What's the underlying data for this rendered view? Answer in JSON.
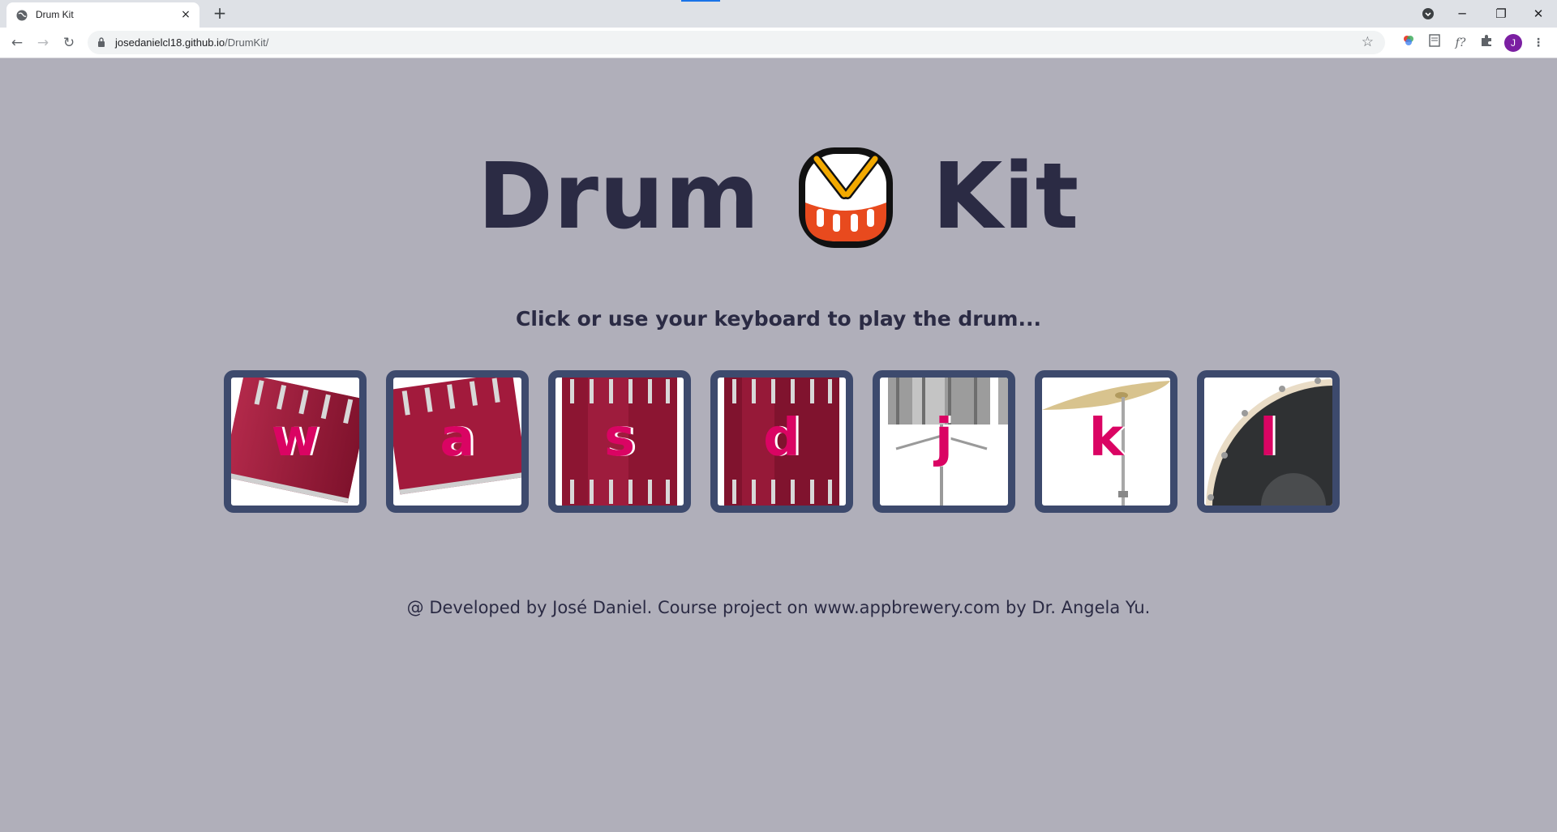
{
  "browser": {
    "tab_title": "Drum Kit",
    "tab_close": "×",
    "new_tab": "+",
    "url_host": "josedanielcl18.github.io",
    "url_path": "/DrumKit/",
    "avatar_letter": "J",
    "nav": {
      "back": "←",
      "forward": "→",
      "reload": "↻"
    },
    "window": {
      "minimize": "─",
      "restore": "❐",
      "close": "✕"
    },
    "extensions": [
      "color-picker-icon",
      "document-icon",
      "font-icon",
      "puzzle-icon"
    ]
  },
  "page": {
    "title_left": "Drum",
    "title_icon": "drum-icon",
    "title_right": "Kit",
    "subtitle": "Click or use your keyboard to play the drum...",
    "drums": [
      {
        "key": "w",
        "image": "tom-drum-angled"
      },
      {
        "key": "a",
        "image": "tom-drum-angled"
      },
      {
        "key": "s",
        "image": "snare-drum"
      },
      {
        "key": "d",
        "image": "snare-drum"
      },
      {
        "key": "j",
        "image": "silver-snare-stand"
      },
      {
        "key": "k",
        "image": "crash-cymbal"
      },
      {
        "key": "l",
        "image": "kick-drum"
      }
    ],
    "footer": "@ Developed by José Daniel. Course project on www.appbrewery.com by Dr. Angela Yu."
  },
  "colors": {
    "background": "#b0afba",
    "text": "#2b2b44",
    "drum_border": "#3d4a6d",
    "letter": "#da0463"
  }
}
